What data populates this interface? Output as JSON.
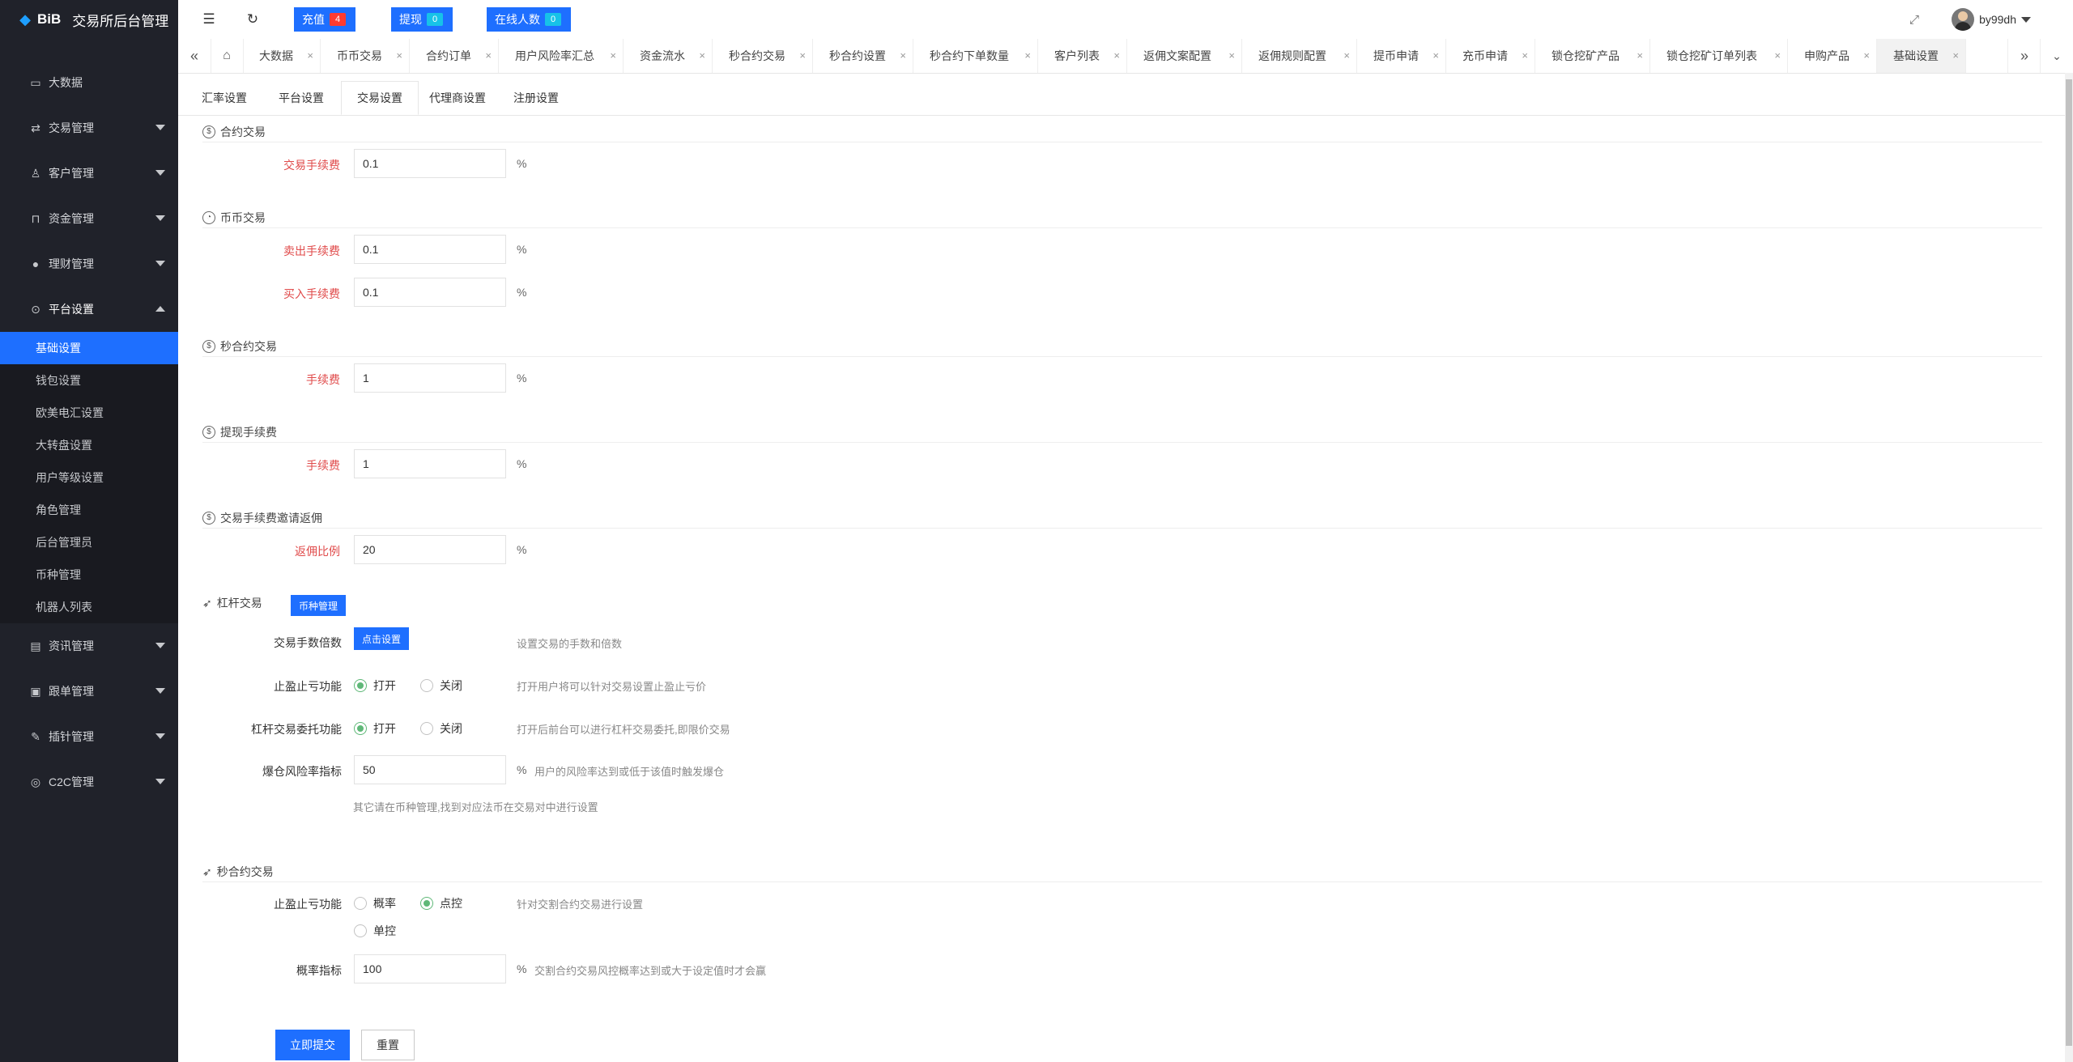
{
  "app": {
    "brand": "BiB",
    "title": "交易所后台管理"
  },
  "sidebar": {
    "items": [
      {
        "label": "大数据",
        "icon": "monitor-icon"
      },
      {
        "label": "交易管理",
        "icon": "exchange-icon"
      },
      {
        "label": "客户管理",
        "icon": "users-icon"
      },
      {
        "label": "资金管理",
        "icon": "lock-icon"
      },
      {
        "label": "理财管理",
        "icon": "piggy-bank-icon"
      },
      {
        "label": "平台设置",
        "icon": "gear-icon"
      },
      {
        "label": "资讯管理",
        "icon": "news-icon"
      },
      {
        "label": "跟单管理",
        "icon": "document-icon"
      },
      {
        "label": "插针管理",
        "icon": "wrench-icon"
      },
      {
        "label": "C2C管理",
        "icon": "target-icon"
      }
    ],
    "sub_items": [
      "基础设置",
      "钱包设置",
      "欧美电汇设置",
      "大转盘设置",
      "用户等级设置",
      "角色管理",
      "后台管理员",
      "币种管理",
      "机器人列表"
    ]
  },
  "header": {
    "recharge": {
      "label": "充值",
      "count": "4"
    },
    "withdraw": {
      "label": "提现",
      "count": "0"
    },
    "online": {
      "label": "在线人数",
      "count": "0"
    },
    "username": "by99dh"
  },
  "tabs": [
    "大数据",
    "币币交易",
    "合约订单",
    "用户风险率汇总",
    "资金流水",
    "秒合约交易",
    "秒合约设置",
    "秒合约下单数量",
    "客户列表",
    "返佣文案配置",
    "返佣规则配置",
    "提币申请",
    "充币申请",
    "锁仓挖矿产品",
    "锁仓挖矿订单列表",
    "申购产品",
    "基础设置"
  ],
  "subtabs": [
    "汇率设置",
    "平台设置",
    "交易设置",
    "代理商设置",
    "注册设置"
  ],
  "form": {
    "contract": {
      "title": "合约交易",
      "fee_label": "交易手续费",
      "fee": "0.1",
      "unit": "%"
    },
    "spot": {
      "title": "币币交易",
      "sell_label": "卖出手续费",
      "sell": "0.1",
      "buy_label": "买入手续费",
      "buy": "0.1",
      "unit": "%"
    },
    "second_contract": {
      "title": "秒合约交易",
      "fee_label": "手续费",
      "fee": "1",
      "unit": "%"
    },
    "withdraw_fee": {
      "title": "提现手续费",
      "fee_label": "手续费",
      "fee": "1",
      "unit": "%"
    },
    "rebate": {
      "title": "交易手续费邀请返佣",
      "ratio_label": "返佣比例",
      "ratio": "20",
      "unit": "%"
    },
    "leverage": {
      "title": "杠杆交易",
      "coin_btn": "币种管理",
      "multiplier_label": "交易手数倍数",
      "multiplier_btn": "点击设置",
      "multiplier_hint": "设置交易的手数和倍数",
      "tpsl_label": "止盈止亏功能",
      "open": "打开",
      "close": "关闭",
      "tpsl_hint": "打开用户将可以针对交易设置止盈止亏价",
      "entrust_label": "杠杆交易委托功能",
      "entrust_hint": "打开后前台可以进行杠杆交易委托,即限价交易",
      "risk_label": "爆仓风险率指标",
      "risk": "50",
      "unit": "%",
      "risk_hint": "用户的风险率达到或低于该值时触发爆仓",
      "note": "其它请在币种管理,找到对应法币在交易对中进行设置"
    },
    "second_contract2": {
      "title": "秒合约交易",
      "tpsl_label": "止盈止亏功能",
      "opt_prob": "概率",
      "opt_point": "点控",
      "opt_single": "单控",
      "tpsl_hint": "针对交割合约交易进行设置",
      "prob_label": "概率指标",
      "prob": "100",
      "unit": "%",
      "prob_hint": "交割合约交易风控概率达到或大于设定值时才会赢"
    },
    "submit": "立即提交",
    "reset": "重置"
  }
}
